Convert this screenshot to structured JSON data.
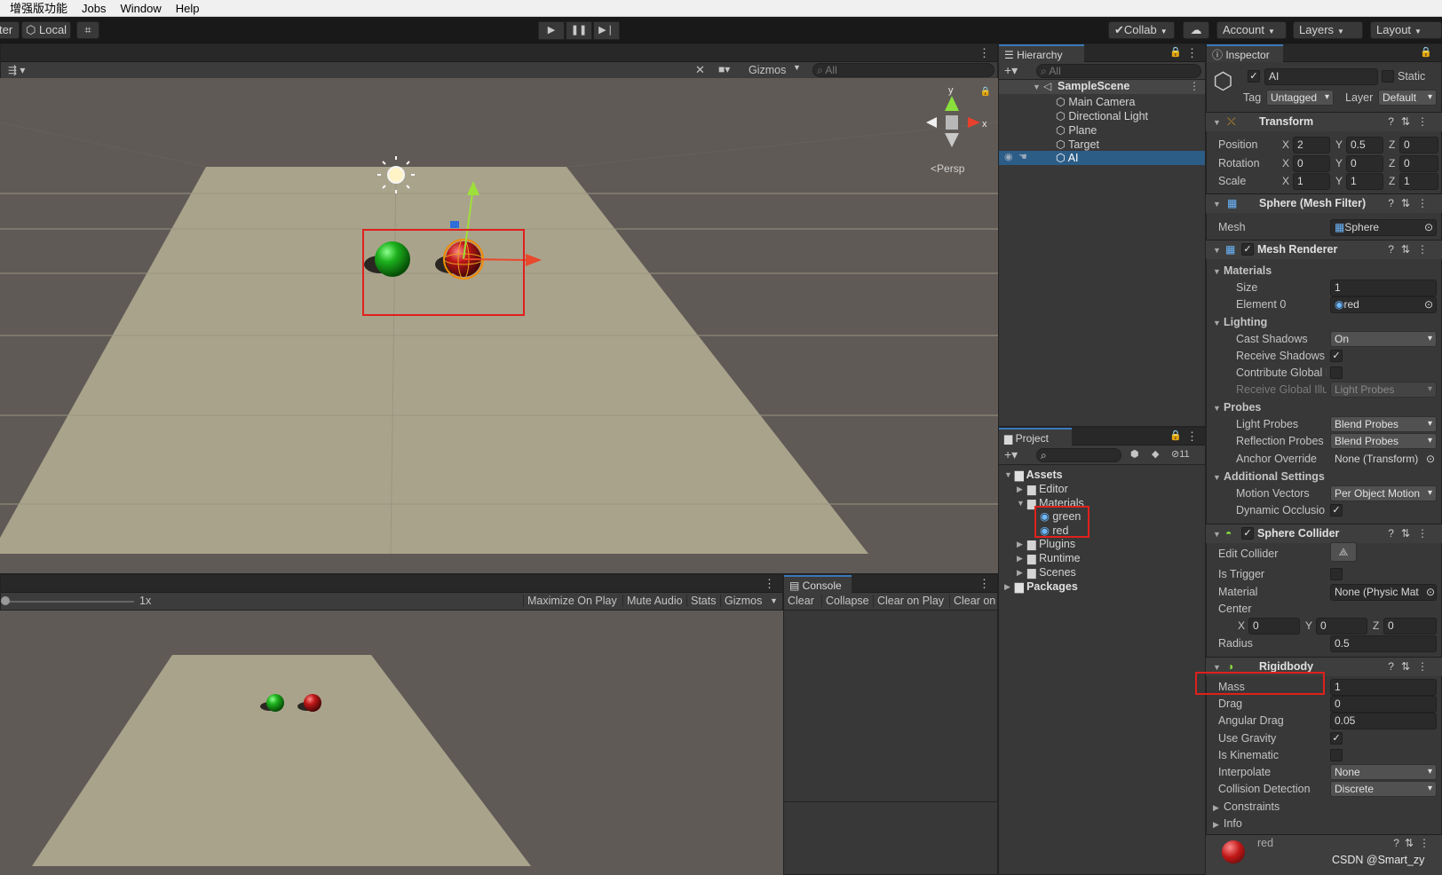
{
  "menubar": {
    "items": [
      "增强版功能",
      "Jobs",
      "Window",
      "Help"
    ]
  },
  "toolbar": {
    "pivot_partial": "ter",
    "local_label": "Local",
    "collab_label": "Collab",
    "account_label": "Account",
    "layers_label": "Layers",
    "layout_label": "Layout"
  },
  "scene": {
    "gizmos_label": "Gizmos",
    "search_placeholder": "All",
    "persp_label": "Persp",
    "axis_x": "x",
    "axis_y": "y"
  },
  "game": {
    "scale_label": "1x",
    "maximize_label": "Maximize On Play",
    "mute_label": "Mute Audio",
    "stats_label": "Stats",
    "gizmos_label": "Gizmos"
  },
  "console": {
    "tab_label": "Console",
    "clear": "Clear",
    "collapse": "Collapse",
    "clear_on_play": "Clear on Play",
    "clear_on_build": "Clear on"
  },
  "hierarchy": {
    "tab_label": "Hierarchy",
    "search_placeholder": "All",
    "scene_name": "SampleScene",
    "items": [
      "Main Camera",
      "Directional Light",
      "Plane",
      "Target",
      "AI"
    ]
  },
  "project": {
    "tab_label": "Project",
    "hidden_count": "11",
    "assets_label": "Assets",
    "editor_label": "Editor",
    "materials_label": "Materials",
    "green_label": "green",
    "red_label": "red",
    "plugins_label": "Plugins",
    "runtime_label": "Runtime",
    "scenes_label": "Scenes",
    "packages_label": "Packages"
  },
  "inspector": {
    "tab_label": "Inspector",
    "object_name": "AI",
    "static_label": "Static",
    "tag_label": "Tag",
    "tag_value": "Untagged",
    "layer_label": "Layer",
    "layer_value": "Default",
    "transform": {
      "title": "Transform",
      "position_label": "Position",
      "rotation_label": "Rotation",
      "scale_label": "Scale",
      "x": "X",
      "y": "Y",
      "z": "Z",
      "position": [
        "2",
        "0.5",
        "0"
      ],
      "rotation": [
        "0",
        "0",
        "0"
      ],
      "scale": [
        "1",
        "1",
        "1"
      ]
    },
    "mesh_filter": {
      "title": "Sphere (Mesh Filter)",
      "mesh_label": "Mesh",
      "mesh_value": "Sphere"
    },
    "mesh_renderer": {
      "title": "Mesh Renderer",
      "materials_label": "Materials",
      "size_label": "Size",
      "size_value": "1",
      "element0_label": "Element 0",
      "element0_value": "red",
      "lighting_label": "Lighting",
      "cast_shadows_label": "Cast Shadows",
      "cast_shadows_value": "On",
      "receive_shadows_label": "Receive Shadows",
      "contribute_gi_label": "Contribute Global I",
      "receive_gi_label": "Receive Global Illu",
      "receive_gi_value": "Light Probes",
      "probes_label": "Probes",
      "light_probes_label": "Light Probes",
      "light_probes_value": "Blend Probes",
      "reflection_probes_label": "Reflection Probes",
      "reflection_probes_value": "Blend Probes",
      "anchor_override_label": "Anchor Override",
      "anchor_override_value": "None (Transform)",
      "additional_settings_label": "Additional Settings",
      "motion_vectors_label": "Motion Vectors",
      "motion_vectors_value": "Per Object Motion",
      "dynamic_occlusion_label": "Dynamic Occlusio"
    },
    "sphere_collider": {
      "title": "Sphere Collider",
      "edit_collider_label": "Edit Collider",
      "is_trigger_label": "Is Trigger",
      "material_label": "Material",
      "material_value": "None (Physic Mat",
      "center_label": "Center",
      "center": [
        "0",
        "0",
        "0"
      ],
      "radius_label": "Radius",
      "radius_value": "0.5"
    },
    "rigidbody": {
      "title": "Rigidbody",
      "mass_label": "Mass",
      "mass_value": "1",
      "drag_label": "Drag",
      "drag_value": "0",
      "angular_drag_label": "Angular Drag",
      "angular_drag_value": "0.05",
      "use_gravity_label": "Use Gravity",
      "is_kinematic_label": "Is Kinematic",
      "interpolate_label": "Interpolate",
      "interpolate_value": "None",
      "collision_detection_label": "Collision Detection",
      "collision_detection_value": "Discrete",
      "constraints_label": "Constraints",
      "info_label": "Info"
    },
    "material_preview_label": "red"
  },
  "watermark": "CSDN @Smart_zy",
  "colors": {
    "accent": "#3a79bb",
    "selection": "#2c5d87",
    "highlight_box": "#e0201c",
    "ground": "#aaa38c",
    "sky": "#5f5a56"
  }
}
